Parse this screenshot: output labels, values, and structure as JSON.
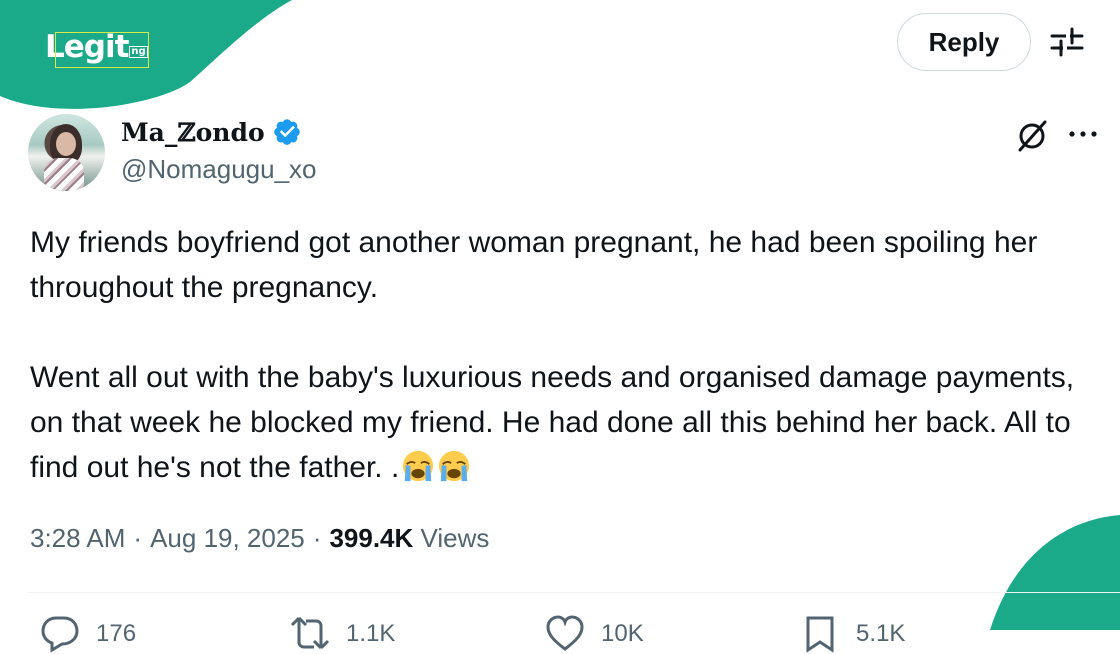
{
  "brand": {
    "logo_text": "Legit",
    "logo_suffix": "ng",
    "colors": {
      "teal": "#1aaa8a",
      "logo_outline": "#d9e84a"
    }
  },
  "header": {
    "reply_label": "Reply",
    "filter_icon": "sliders-icon"
  },
  "tweet": {
    "author": {
      "display_name": "Ma_ℤondo",
      "handle": "@Nomagugu_xo",
      "verified": true,
      "verified_color": "#1d9bf0"
    },
    "text_p1": "My friends boyfriend got another woman pregnant, he had been spoiling her throughout the pregnancy.",
    "text_p2": "Went all out with the baby's luxurious needs and organised damage payments, on that week he blocked my friend. He had done all this behind her back. All to find out he's not the father. .",
    "emoji": [
      "loudly-crying-face",
      "loudly-crying-face"
    ],
    "time": "3:28 AM",
    "date": "Aug 19, 2025",
    "separator": "·",
    "views_count": "399.4K",
    "views_label": "Views"
  },
  "actions": [
    {
      "icon": "reply-bubble-icon",
      "count": "176"
    },
    {
      "icon": "retweet-icon",
      "count": "1.1K"
    },
    {
      "icon": "heart-icon",
      "count": "10K"
    },
    {
      "icon": "bookmark-icon",
      "count": "5.1K"
    }
  ],
  "icons": {
    "grok": "grok-slash-icon",
    "more": "more-dots-icon"
  }
}
